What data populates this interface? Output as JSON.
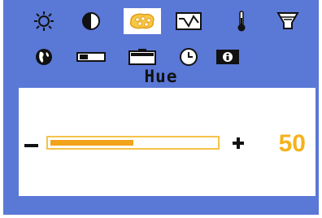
{
  "osd": {
    "title": "Hue",
    "selected_menu": "hue",
    "menu_row1": [
      "brightness-icon",
      "contrast-icon",
      "hue-icon",
      "waveform-icon",
      "thermometer-icon",
      "funnel-icon"
    ],
    "menu_row2": [
      "globe-icon",
      "horizontal-position-icon",
      "vertical-position-icon",
      "clock-icon",
      "information-icon"
    ],
    "slider": {
      "minus_symbol": "−",
      "plus_symbol": "+",
      "value_text": "50",
      "level_percent": 50
    },
    "colors": {
      "background": "#5a78d6",
      "accent": "#f5b21b",
      "selected_bg": "#ffffff"
    }
  }
}
